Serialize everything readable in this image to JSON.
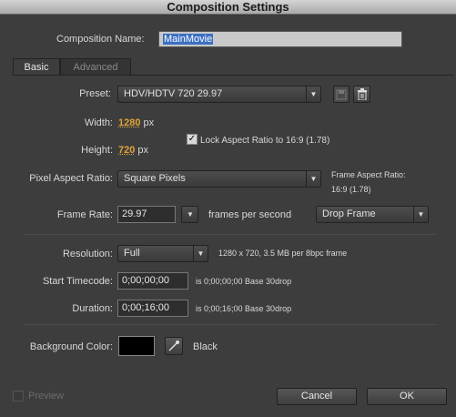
{
  "window": {
    "title": "Composition Settings"
  },
  "composition_name": {
    "label": "Composition Name:",
    "value": "MainMovie"
  },
  "tabs": [
    {
      "label": "Basic",
      "active": true
    },
    {
      "label": "Advanced",
      "active": false
    }
  ],
  "preset": {
    "label": "Preset:",
    "value": "HDV/HDTV 720 29.97",
    "save_icon": "save-preset-icon",
    "delete_icon": "trash-icon"
  },
  "width": {
    "label": "Width:",
    "value": "1280",
    "unit": "px"
  },
  "height": {
    "label": "Height:",
    "value": "720",
    "unit": "px"
  },
  "lock_aspect": {
    "label": "Lock Aspect Ratio to 16:9 (1.78)",
    "checked": true
  },
  "pixel_aspect": {
    "label": "Pixel Aspect Ratio:",
    "value": "Square Pixels"
  },
  "frame_aspect": {
    "label": "Frame Aspect Ratio:",
    "value": "16:9 (1.78)"
  },
  "frame_rate": {
    "label": "Frame Rate:",
    "value": "29.97",
    "suffix": "frames per second",
    "drop_frame": "Drop Frame"
  },
  "resolution": {
    "label": "Resolution:",
    "value": "Full",
    "info": "1280 x 720, 3.5 MB per 8bpc frame"
  },
  "start_timecode": {
    "label": "Start Timecode:",
    "value": "0;00;00;00",
    "info": "is 0;00;00;00  Base 30drop"
  },
  "duration": {
    "label": "Duration:",
    "value": "0;00;16;00",
    "info": "is 0;00;16;00  Base 30drop"
  },
  "background_color": {
    "label": "Background Color:",
    "name": "Black",
    "swatch": "#000000",
    "eyedropper_icon": "eyedropper-icon"
  },
  "footer": {
    "preview_label": "Preview",
    "preview_checked": false,
    "cancel_label": "Cancel",
    "ok_label": "OK"
  }
}
